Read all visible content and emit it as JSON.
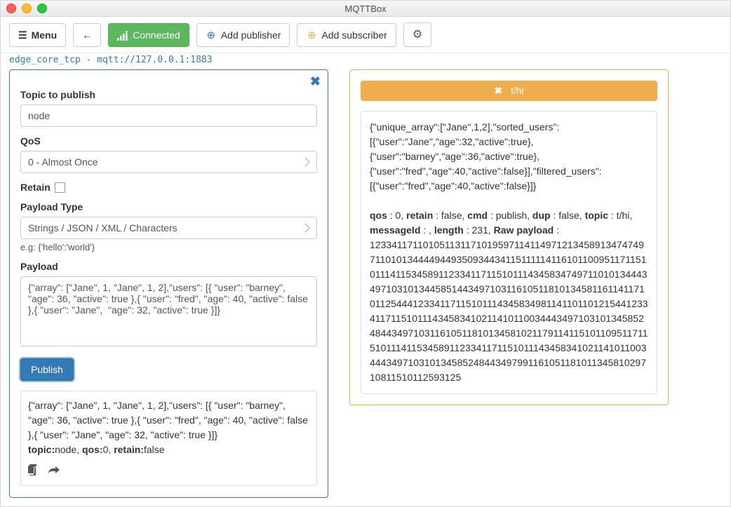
{
  "window": {
    "title": "MQTTBox"
  },
  "toolbar": {
    "menu_label": "Menu",
    "connected_label": "Connected",
    "add_publisher_label": "Add publisher",
    "add_subscriber_label": "Add subscriber"
  },
  "connection": {
    "label": "edge_core_tcp - mqtt://127.0.0.1:1883"
  },
  "publisher": {
    "topic_label": "Topic to publish",
    "topic_value": "node",
    "qos_label": "QoS",
    "qos_value": "0 - Almost Once",
    "retain_label": "Retain",
    "retain_checked": false,
    "payload_type_label": "Payload Type",
    "payload_type_value": "Strings / JSON / XML / Characters",
    "payload_type_hint": "e.g: {'hello':'world'}",
    "payload_label": "Payload",
    "payload_value": "{\"array\": [\"Jane\", 1, \"Jane\", 1, 2],\"users\": [{ \"user\": \"barney\", \"age\": 36, \"active\": true },{ \"user\": \"fred\", \"age\": 40, \"active\": false },{ \"user\": \"Jane\",  \"age\": 32, \"active\": true }]}",
    "publish_button": "Publish",
    "history": {
      "body": "{\"array\": [\"Jane\", 1, \"Jane\", 1, 2],\"users\": [{ \"user\": \"barney\", \"age\": 36, \"active\": true },{ \"user\": \"fred\", \"age\": 40, \"active\": false },{ \"user\": \"Jane\", \"age\": 32, \"active\": true }]}",
      "meta_topic_label": "topic:",
      "meta_topic_value": "node,",
      "meta_qos_label": "qos:",
      "meta_qos_value": "0,",
      "meta_retain_label": "retain:",
      "meta_retain_value": "false"
    }
  },
  "subscriber": {
    "topic": "t/hi",
    "message_body": "{\"unique_array\":[\"Jane\",1,2],\"sorted_users\":[{\"user\":\"Jane\",\"age\":32,\"active\":true},{\"user\":\"barney\",\"age\":36,\"active\":true},{\"user\":\"fred\",\"age\":40,\"active\":false}],\"filtered_users\":[{\"user\":\"fred\",\"age\":40,\"active\":false}]}",
    "meta": {
      "qos_label": "qos",
      "qos_value": " : 0, ",
      "retain_label": "retain",
      "retain_value": " : false, ",
      "cmd_label": "cmd",
      "cmd_value": " : publish, ",
      "dup_label": "dup",
      "dup_value": " : false, ",
      "topic_label": "topic",
      "topic_value": " : t/hi, ",
      "msgid_label": "messageId",
      "msgid_value": " : , ",
      "length_label": "length",
      "length_value": " : 231, ",
      "raw_label": "Raw payload",
      "raw_value": " : 1233411711010511311710195971141149712134589134747497110101344449449350934434115111114116101100951171151011141153458911233411711510111434583474971101013444349710310134458514434971031161051181013458116114117101125444123341171151011143458349811411011012154412334117115101114345834102114101100344434971031013458524844349710311610511810134581021179114115101109511711510111411534589112334117115101114345834102114101100344434971031013458524844349799116105118101134581029710811510112593125"
    }
  }
}
